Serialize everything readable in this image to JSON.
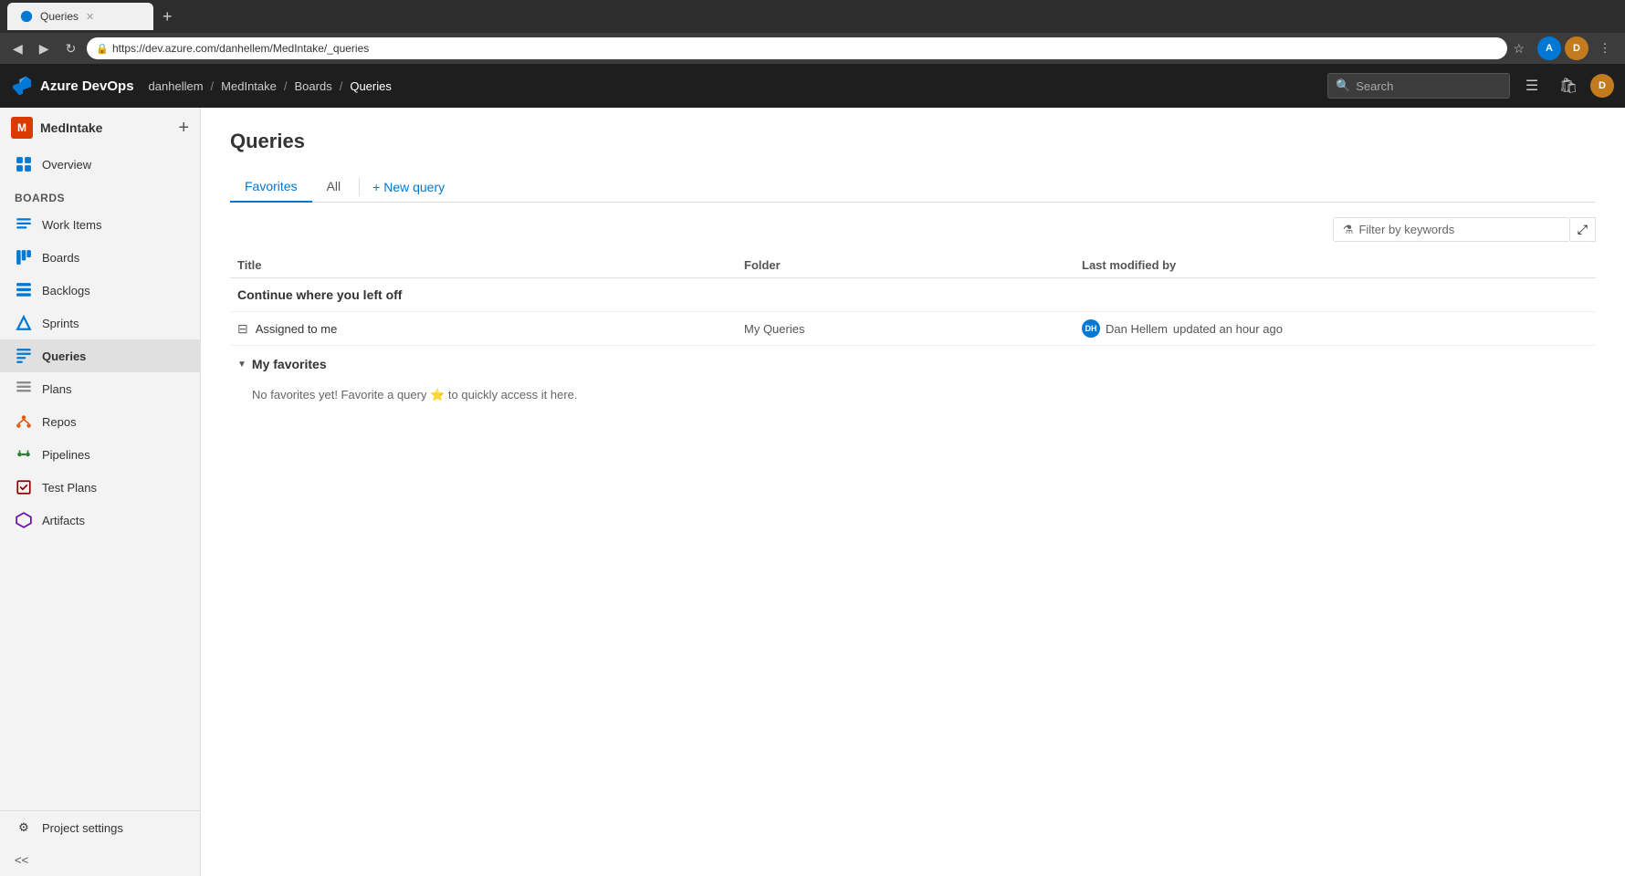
{
  "browser": {
    "tab_title": "Queries",
    "tab_url": "https://dev.azure.com/danhellem/MedIntake/_queries",
    "back_btn": "◀",
    "forward_btn": "▶",
    "refresh_btn": "↻"
  },
  "header": {
    "app_name": "Azure DevOps",
    "breadcrumbs": [
      {
        "label": "danhellem",
        "link": true
      },
      {
        "label": "MedIntake",
        "link": true
      },
      {
        "label": "Boards",
        "link": true
      },
      {
        "label": "Queries",
        "link": false
      }
    ],
    "search_placeholder": "Search"
  },
  "sidebar": {
    "project_name": "MedIntake",
    "project_initial": "M",
    "nav_items": [
      {
        "id": "overview",
        "label": "Overview",
        "icon": "overview"
      },
      {
        "id": "boards",
        "label": "Boards",
        "icon": "boards"
      },
      {
        "id": "work-items",
        "label": "Work Items",
        "icon": "work-items"
      },
      {
        "id": "boards-sub",
        "label": "Boards",
        "icon": "boards-sub"
      },
      {
        "id": "backlogs",
        "label": "Backlogs",
        "icon": "backlogs"
      },
      {
        "id": "sprints",
        "label": "Sprints",
        "icon": "sprints"
      },
      {
        "id": "queries",
        "label": "Queries",
        "icon": "queries",
        "active": true
      },
      {
        "id": "plans",
        "label": "Plans",
        "icon": "plans"
      },
      {
        "id": "repos",
        "label": "Repos",
        "icon": "repos"
      },
      {
        "id": "pipelines",
        "label": "Pipelines",
        "icon": "pipelines"
      },
      {
        "id": "test-plans",
        "label": "Test Plans",
        "icon": "test-plans"
      },
      {
        "id": "artifacts",
        "label": "Artifacts",
        "icon": "artifacts"
      }
    ],
    "project_settings_label": "Project settings",
    "collapse_label": "<<"
  },
  "main": {
    "page_title": "Queries",
    "tabs": [
      {
        "id": "favorites",
        "label": "Favorites",
        "active": true
      },
      {
        "id": "all",
        "label": "All",
        "active": false
      }
    ],
    "new_query_label": "+ New query",
    "filter_placeholder": "Filter by keywords",
    "table": {
      "columns": [
        "Title",
        "Folder",
        "Last modified by"
      ],
      "continue_section_title": "Continue where you left off",
      "rows": [
        {
          "title": "Assigned to me",
          "folder": "My Queries",
          "modified_by": "Dan Hellem",
          "modified_time": "updated an hour ago"
        }
      ],
      "my_favorites_title": "My favorites",
      "no_favorites_text": "No favorites yet! Favorite a query ⭐ to quickly access it here."
    }
  }
}
